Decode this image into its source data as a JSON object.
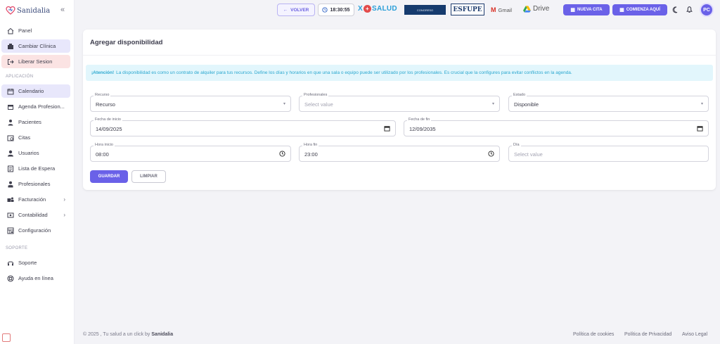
{
  "brand": {
    "name": "Sanidalia"
  },
  "sidebar": {
    "items": [
      {
        "label": "Panel",
        "icon": "home-icon"
      },
      {
        "label": "Cambiar Clínica",
        "icon": "clinic-icon"
      },
      {
        "label": "Liberar Sesion",
        "icon": "logout-icon"
      }
    ],
    "section_app": "APLICACIÓN",
    "app_items": [
      {
        "label": "Calendario",
        "icon": "calendar-icon"
      },
      {
        "label": "Agenda Profesion...",
        "icon": "agenda-icon"
      },
      {
        "label": "Pacientes",
        "icon": "patients-icon"
      },
      {
        "label": "Citas",
        "icon": "appointments-icon"
      },
      {
        "label": "Usuarios",
        "icon": "users-icon"
      },
      {
        "label": "Lista de Espera",
        "icon": "list-icon"
      },
      {
        "label": "Profesionales",
        "icon": "professionals-icon"
      },
      {
        "label": "Facturación",
        "icon": "billing-icon"
      },
      {
        "label": "Contabilidad",
        "icon": "accounting-icon"
      },
      {
        "label": "Configuración",
        "icon": "settings-icon"
      }
    ],
    "section_support": "SOPORTE",
    "support_items": [
      {
        "label": "Soporte",
        "icon": "headset-icon"
      },
      {
        "label": "Ayuda en línea",
        "icon": "lifebuoy-icon"
      }
    ]
  },
  "topbar": {
    "back_label": "VOLVER",
    "clock": "18:30:55",
    "logo_xsalud_a": "X",
    "logo_xsalud_b": "SALUD",
    "logo_congreso": "CONGRESO",
    "logo_esfupe": "ESFUPE",
    "gmail_label": "Gmail",
    "drive_label": "Drive",
    "nueva_cita_label": "NUEVA CITA",
    "comienza_label": "COMIENZA AQUÍ",
    "avatar_initials": "PC"
  },
  "card": {
    "title": "Agregar disponibilidad",
    "alert_strong": "¡Atención!",
    "alert_text": "La disponibilidad es como un contrato de alquiler para tus recursos. Define los días y horarios en que una sala o equipo puede ser utilizado por los profesionales. Es crucial que la configures para evitar conflictos en la agenda.",
    "fields": {
      "recurso": {
        "label": "Recurso",
        "value": "Recurso"
      },
      "profesionales": {
        "label": "Profesionales",
        "placeholder": "Select value"
      },
      "estado": {
        "label": "Estado",
        "value": "Disponible"
      },
      "fecha_inicio": {
        "label": "Fecha de inicio",
        "value": "14/09/2025"
      },
      "fecha_fin": {
        "label": "Fecha de fin",
        "value": "12/09/2035"
      },
      "hora_inicio": {
        "label": "Hora inicio",
        "value": "08:00"
      },
      "hora_fin": {
        "label": "Hora fin",
        "value": "23:00"
      },
      "dia": {
        "label": "Día",
        "placeholder": "Select value"
      }
    },
    "save_label": "GUARDAR",
    "clear_label": "LIMPIAR"
  },
  "footer": {
    "copyright": "© 2025 , Tu salud a un click by",
    "copyright_brand": "Sanidalia",
    "links": [
      "Política de cookies",
      "Política de Privacidad",
      "Aviso Legal"
    ]
  },
  "colors": {
    "primary": "#6a61e8",
    "alert_bg": "#e2f6fc",
    "alert_text": "#29a7cf",
    "logout_bg": "#fbe3e3"
  }
}
